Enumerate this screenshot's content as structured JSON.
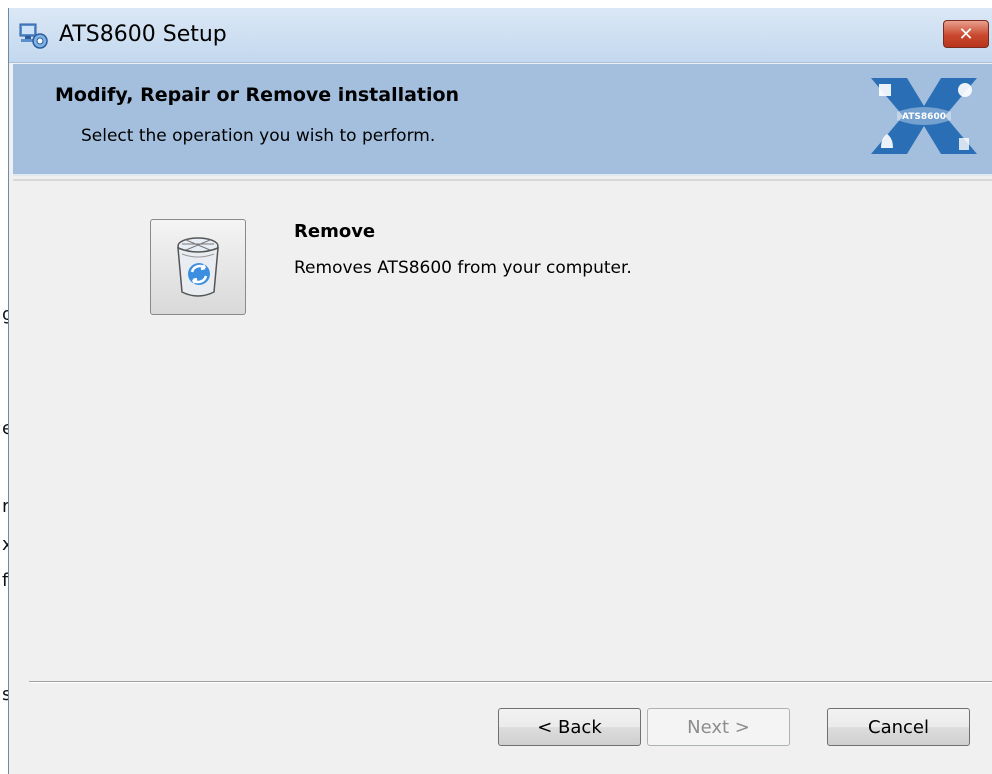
{
  "window": {
    "title": "ATS8600 Setup",
    "close_label": "✕"
  },
  "banner": {
    "title": "Modify, Repair or Remove installation",
    "subtitle": "Select the operation you wish to perform.",
    "logo_text": "ATS8600"
  },
  "option": {
    "title": "Remove",
    "description": "Removes ATS8600 from your computer.",
    "icon": "recycle-bin-icon"
  },
  "buttons": {
    "back": "< Back",
    "next": "Next >",
    "cancel": "Cancel"
  },
  "background_fragments": [
    "g",
    "e",
    "r",
    "x",
    "f",
    "s"
  ],
  "colors": {
    "banner": "#a3bfdd",
    "window_bg": "#f0f0f0",
    "close_button": "#c9482e",
    "logo_blue": "#2a6fb5"
  }
}
